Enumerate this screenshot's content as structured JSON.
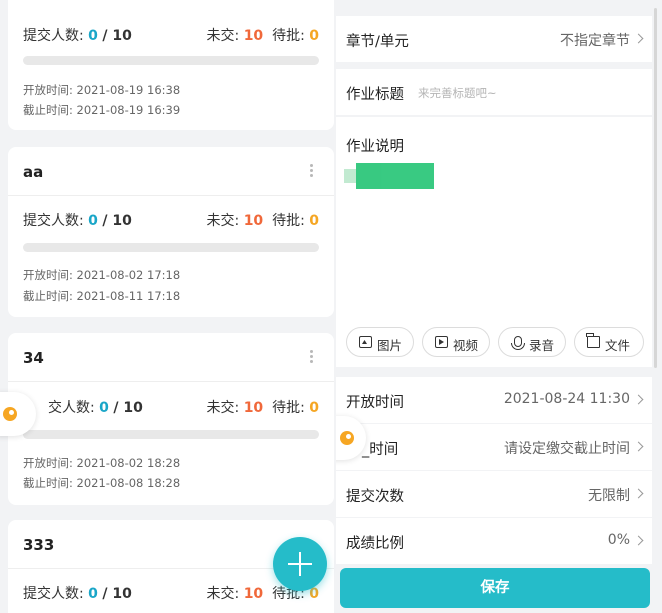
{
  "assignments": [
    {
      "title": "",
      "submitted_label": "提交人数:",
      "submitted": "0",
      "total_label": "/ 10",
      "unsubmitted_label": "未交:",
      "unsubmitted": "10",
      "pending_label": "待批:",
      "pending": "0",
      "progress": 0,
      "open_time": "开放时间: 2021-08-19 16:38",
      "due_time": "截止时间: 2021-08-19 16:39"
    },
    {
      "title": "aa",
      "submitted_label": "提交人数:",
      "submitted": "0",
      "total_label": "/ 10",
      "unsubmitted_label": "未交:",
      "unsubmitted": "10",
      "pending_label": "待批:",
      "pending": "0",
      "progress": 0,
      "open_time": "开放时间: 2021-08-02 17:18",
      "due_time": "截止时间: 2021-08-11 17:18"
    },
    {
      "title": "34",
      "submitted_label": "交人数:",
      "submitted": "0",
      "total_label": "/ 10",
      "unsubmitted_label": "未交:",
      "unsubmitted": "10",
      "pending_label": "待批:",
      "pending": "0",
      "progress": 0,
      "open_time": "开放时间: 2021-08-02 18:28",
      "due_time": "截止时间: 2021-08-08 18:28"
    },
    {
      "title": "333",
      "submitted_label": "提交人数:",
      "submitted": "0",
      "total_label": "/ 10",
      "unsubmitted_label": "未交:",
      "unsubmitted": "10",
      "pending_label": "待批:",
      "pending": "0"
    }
  ],
  "form": {
    "chapter_label": "章节/单元",
    "chapter_value": "不指定章节",
    "title_label": "作业标题",
    "title_placeholder": "来完善标题吧~",
    "desc_label": "作业说明",
    "media_buttons": [
      "图片",
      "视频",
      "录音",
      "文件"
    ],
    "open_time_label": "开放时间",
    "open_time_value": "2021-08-24 11:30",
    "due_time_label": "_时间",
    "due_time_value": "请设定缴交截止时间",
    "attempts_label": "提交次数",
    "attempts_value": "无限制",
    "score_ratio_label": "成绩比例",
    "score_ratio_value": "0%",
    "save_label": "保存"
  },
  "icons": {
    "fab": "plus-icon",
    "side_float": "palette-icon",
    "chevron": "chevron-right-icon"
  },
  "colors": {
    "accent": "#25bcc9",
    "count_blue": "#1aa6c8",
    "unsubmitted_red": "#f0683a",
    "pending_yellow": "#f5a623"
  }
}
